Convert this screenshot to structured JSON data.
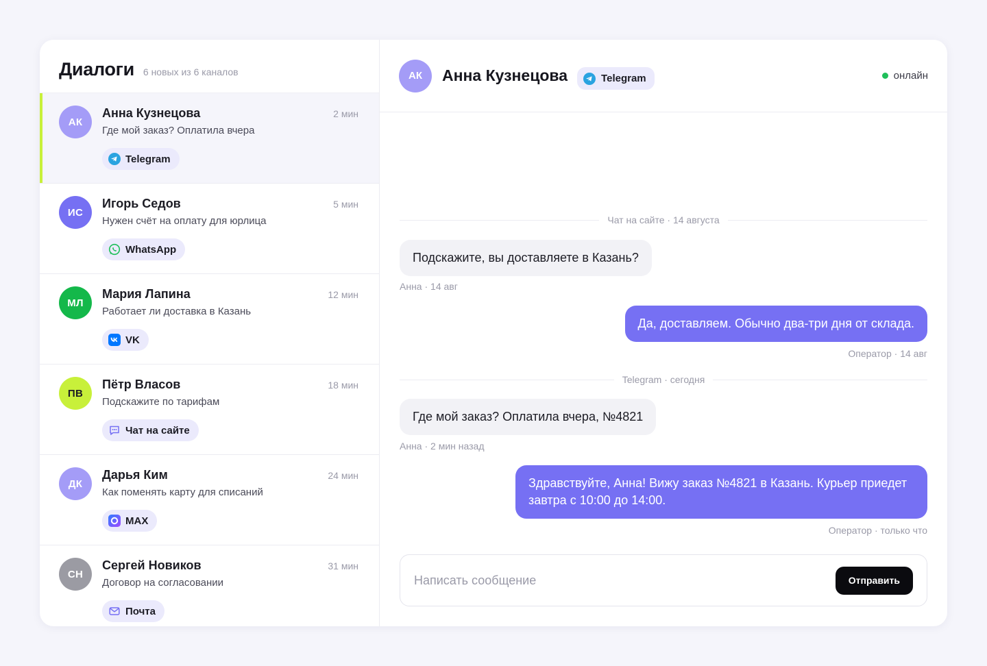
{
  "sidebar": {
    "title": "Диалоги",
    "subtitle": "6 новых из 6 каналов",
    "dialogs": [
      {
        "initials": "АК",
        "name": "Анна Кузнецова",
        "time": "2 мин",
        "preview": "Где мой заказ? Оплатила вчера",
        "channel": "Telegram",
        "channel_icon": "telegram-icon",
        "avatar_color": "#a49cf7",
        "active": true
      },
      {
        "initials": "ИС",
        "name": "Игорь Седов",
        "time": "5 мин",
        "preview": "Нужен счёт на оплату для юрлица",
        "channel": "WhatsApp",
        "channel_icon": "whatsapp-icon",
        "avatar_color": "#7670f3",
        "active": false
      },
      {
        "initials": "МЛ",
        "name": "Мария Лапина",
        "time": "12 мин",
        "preview": "Работает ли доставка в Казань",
        "channel": "VK",
        "channel_icon": "vk-icon",
        "avatar_color": "#14b84a",
        "active": false
      },
      {
        "initials": "ПВ",
        "name": "Пётр Власов",
        "time": "18 мин",
        "preview": "Подскажите по тарифам",
        "channel": "Чат на сайте",
        "channel_icon": "site-chat-icon",
        "avatar_color": "#c8f03a",
        "active": false
      },
      {
        "initials": "ДК",
        "name": "Дарья Ким",
        "time": "24 мин",
        "preview": "Как поменять карту для списаний",
        "channel": "MAX",
        "channel_icon": "max-icon",
        "avatar_color": "#a49cf7",
        "active": false
      },
      {
        "initials": "СН",
        "name": "Сергей Новиков",
        "time": "31 мин",
        "preview": "Договор на согласовании",
        "channel": "Почта",
        "channel_icon": "mail-icon",
        "avatar_color": "#9b9ba3",
        "active": false
      }
    ]
  },
  "chat": {
    "initials": "АК",
    "name": "Анна Кузнецова",
    "channel": "Telegram",
    "status": "онлайн",
    "dividers": [
      "Чат на сайте · 14 августа",
      "Telegram · сегодня"
    ],
    "messages": [
      {
        "direction": "in",
        "text": "Подскажите, вы доставляете в Казань?",
        "meta": "Анна · 14 авг"
      },
      {
        "direction": "out",
        "text": "Да, доставляем. Обычно два-три дня от склада.",
        "meta": "Оператор · 14 авг"
      },
      {
        "direction": "in",
        "text": "Где мой заказ? Оплатила вчера, №4821",
        "meta": "Анна · 2 мин назад"
      },
      {
        "direction": "out",
        "text": "Здравствуйте, Анна! Вижу заказ №4821 в Казань. Курьер приедет завтра с 10:00 до 14:00.",
        "meta": "Оператор · только что"
      }
    ],
    "composer": {
      "placeholder": "Написать сообщение",
      "send_label": "Отправить"
    }
  },
  "colors": {
    "accent": "#7670f3",
    "active_marker": "#c8f03a",
    "online": "#1fbf5a",
    "chip_bg": "#ebeafc"
  }
}
